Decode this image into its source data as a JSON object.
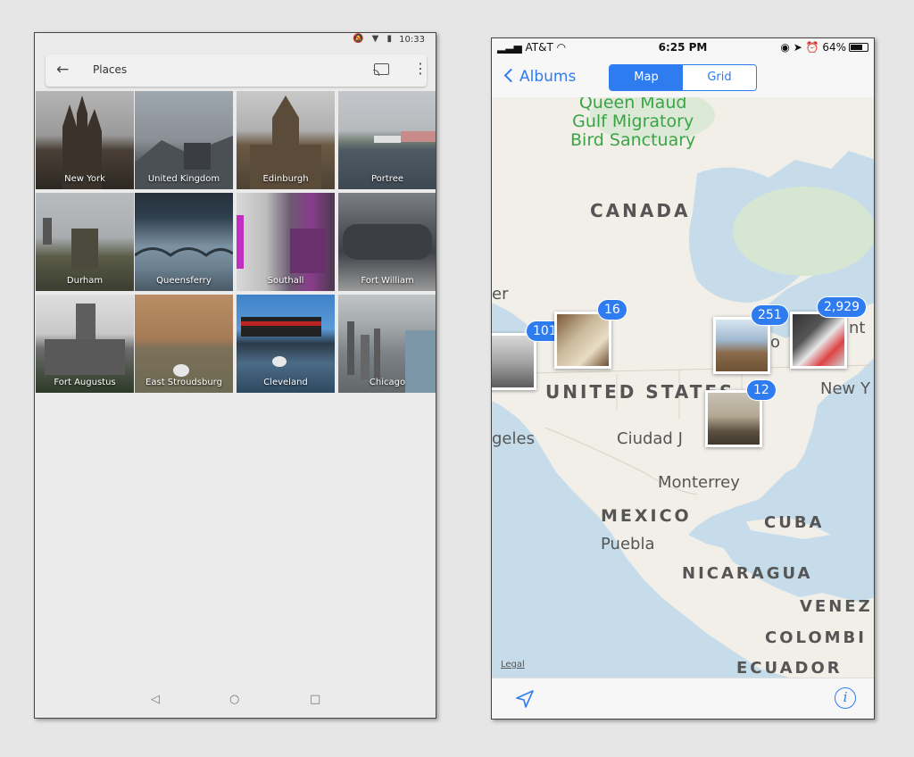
{
  "android": {
    "status": {
      "time": "10:33"
    },
    "appbar": {
      "back_icon": "arrow-left-icon",
      "title": "Places",
      "cast_icon": "cast-icon",
      "menu_icon": "more-vert-icon"
    },
    "places": [
      {
        "label": "New York",
        "icon": "photo-thumbnail"
      },
      {
        "label": "United Kingdom",
        "icon": "photo-thumbnail"
      },
      {
        "label": "Edinburgh",
        "icon": "photo-thumbnail"
      },
      {
        "label": "Portree",
        "icon": "photo-thumbnail"
      },
      {
        "label": "Durham",
        "icon": "photo-thumbnail"
      },
      {
        "label": "Queensferry",
        "icon": "photo-thumbnail"
      },
      {
        "label": "Southall",
        "icon": "photo-thumbnail"
      },
      {
        "label": "Fort William",
        "icon": "photo-thumbnail"
      },
      {
        "label": "Fort Augustus",
        "icon": "photo-thumbnail"
      },
      {
        "label": "East Stroudsburg",
        "icon": "photo-thumbnail"
      },
      {
        "label": "Cleveland",
        "icon": "photo-thumbnail"
      },
      {
        "label": "Chicago",
        "icon": "photo-thumbnail"
      }
    ],
    "navbar": {
      "back": "◁",
      "home": "○",
      "recents": "□"
    }
  },
  "ios": {
    "status": {
      "carrier": "AT&T",
      "time": "6:25 PM",
      "battery": "64%"
    },
    "nav": {
      "back_label": "Albums",
      "segments": [
        "Map",
        "Grid"
      ],
      "selected": "Map"
    },
    "map": {
      "labels": {
        "park": [
          "Queen Maud",
          "Gulf Migratory",
          "Bird Sanctuary"
        ],
        "canada": "CANADA",
        "us": "UNITED STATES",
        "mexico": "MEXICO",
        "cuba": "CUBA",
        "nicaragua": "NICARAGUA",
        "venezuela": "VENEZ",
        "colombia": "COLOMBI",
        "ecuador": "ECUADOR",
        "angeles": "geles",
        "ciudad": "Ciudad J",
        "monterrey": "Monterrey",
        "puebla": "Puebla",
        "newyork": "New Y",
        "fragment_er": "er",
        "fragment_o": "o",
        "fragment_nt": "nt"
      },
      "clusters": [
        {
          "count": "101"
        },
        {
          "count": "16"
        },
        {
          "count": "251"
        },
        {
          "count": "2,929"
        },
        {
          "count": "12"
        }
      ],
      "legal": "Legal"
    },
    "toolbar": {
      "location_icon": "location-arrow-icon",
      "info_icon": "info-icon",
      "info_glyph": "i"
    },
    "colors": {
      "accent": "#2f7bf0",
      "park": "#3aa446",
      "water": "#c6dcea",
      "land": "#f1efe8"
    }
  }
}
